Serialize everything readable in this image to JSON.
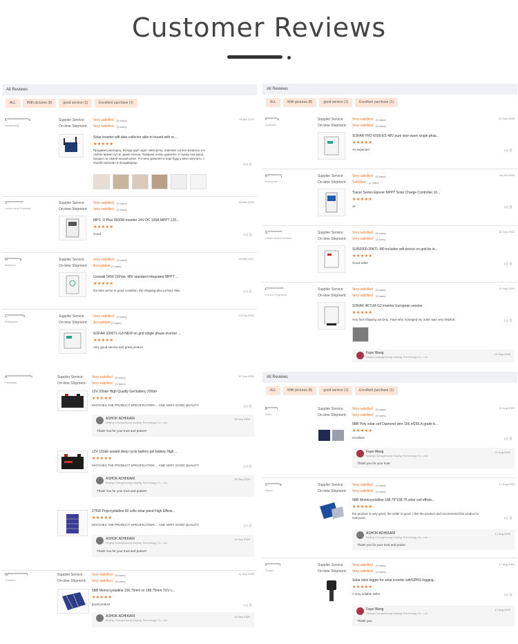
{
  "page_title": "Customer Reviews",
  "panel": {
    "header": "All Reviews",
    "chips": [
      "ALL",
      "With pictures (8)",
      "good service (1)",
      "Excellent purchase (1)"
    ]
  },
  "labels": {
    "supplier": "Supplier Service:",
    "shipment": "On-time Shipment:"
  },
  "left_top": [
    {
      "name": "K****************s",
      "country": "Kazakhstan",
      "date": "05 Apr 2021",
      "supplier": "Very satisfied",
      "supplier_sub": "(5 stars)",
      "shipment": "Very satisfied",
      "shipment_sub": "(5 stars)",
      "product": "Solar inverter wifi data collector able to bound with m...",
      "text": [
        "Продавец молодец, всегда идет идет навстречу, отвечает на все вопросы и в",
        "любое время суток, даже Ночью. Товаром очень доволен, и скажу она дала,",
        "продал по самой низкой цене. Я очень доволен и еще буду у мне покупать, с",
        "пасибо магазин и продавщице."
      ],
      "likes": "0"
    },
    {
      "name": "S************",
      "country": "United Arab Emirates",
      "date": "20 Mar 2021",
      "supplier": "Very satisfied",
      "supplier_sub": "(5 stars)",
      "shipment": "Very satisfied",
      "shipment_sub": "(5 stars)",
      "product": "MPS -V Plus 3500W inverter 24V DC 100A MPPT 120...",
      "text": [
        "Good"
      ],
      "likes": "0"
    },
    {
      "name": "M*********a",
      "country": "Malaysia",
      "date": "04 Mar 2021",
      "supplier": "Very satisfied",
      "supplier_sub": "(5 stars)",
      "shipment": "Acceptable",
      "shipment_sub": "(3 stars)",
      "product": "Growatt 5KW 230Vac 48V standard integrated MPPT ...",
      "text": [
        "the item arrive in good condition. the shipping also jut bad. thks"
      ],
      "likes": "0"
    },
    {
      "name": "C************s",
      "country": "Philippines",
      "date": "23 Feb 2021",
      "supplier": "Very satisfied",
      "supplier_sub": "(5 stars)",
      "shipment": "Acceptable",
      "shipment_sub": "(3 stars)",
      "product": "SOFAR 3300TL-G3-NEW on grid single phase inverter ...",
      "text": [
        "Very good service and great product"
      ],
      "likes": "0"
    }
  ],
  "left_bottom": {
    "name": "A******************r",
    "country": "Paraguay",
    "date": "12 Sep 2020",
    "supplier": "Very satisfied",
    "supplier_sub": "(5 stars)",
    "shipment": "Very satisfied",
    "shipment_sub": "(5 stars)",
    "items": [
      {
        "product": "12V 200ah High Quality Gel battery 200ah",
        "text": "MATCHES THE PRODUCT SPECIFICATION ... AND VERY GOOD QUALITY",
        "likes": "0",
        "reply_name": "ASHOK ADHIKARI",
        "reply_company": "Beijing Changchuang Kaiying Technology Co., Ltd.",
        "reply_date": "15 Sep 2020",
        "reply_text": "Thank You for your trust and praise!!"
      },
      {
        "product": "12V 150ah sealed deep cycle battery gel battery High ...",
        "text": "MATCHES THE PRODUCT SPECIFICATION ... AND VERY GOOD QUALITY",
        "likes": "0",
        "reply_name": "ASHOK ADHIKARI",
        "reply_company": "Beijing Changchuang Kaiying Technology Co., Ltd.",
        "reply_date": "15 Sep 2020",
        "reply_text": "Thank You for your trust and praise!!"
      },
      {
        "product": "275W Polycrystalline 60 cells solar panel high Efficie...",
        "text": "MATCHES THE PRODUCT SPECIFICATION ... AND VERY GOOD QUALITY",
        "likes": "0",
        "reply_name": "ASHOK ADHIKARI",
        "reply_company": "Beijing Changchuang Kaiying Technology Co., Ltd.",
        "reply_date": "15 Sep 2020",
        "reply_text": "Thank You for your trust and praise!!"
      }
    ],
    "next": {
      "name": "W**************r",
      "country": "Thailand",
      "date": "11 Sep 2020",
      "supplier": "Very satisfied",
      "supplier_sub": "(5 stars)",
      "shipment": "Very satisfied",
      "shipment_sub": "(5 stars)",
      "product": "5BB Monocrystalline 156.75mm or 158.75mm TUV c...",
      "text": "good product",
      "likes": "0",
      "reply_name": "ASHOK ADHIKARI",
      "reply_company": "Beijing Changchuang Kaiying Technology Co., Ltd.",
      "reply_date": "13 Sep 2020"
    }
  },
  "right_top": [
    {
      "name": "P*******a",
      "country": "Australia",
      "date": "01 Dec 2020",
      "supplier": "Very satisfied",
      "supplier_sub": "(5 stars)",
      "shipment": "Very satisfied",
      "shipment_sub": "(5 stars)",
      "product": "SOFAR HYD 6000-ES 48V pure sine wave single phas...",
      "text": "As expected",
      "likes": "0"
    },
    {
      "name": "R**********j",
      "country": "Indonesia",
      "date": "08 Oct 2020",
      "supplier": "Very satisfied",
      "supplier_sub": "(5 stars)",
      "shipment": "Satisfied",
      "shipment_sub": "(4 stars)",
      "product": "Tracer Series Epever MPPT Solar Charge Controller 10...",
      "text": "ok",
      "likes": "0"
    },
    {
      "name": "S***********",
      "country": "United Arab Emirates",
      "date": "30 Sep 2020",
      "supplier": "Very satisfied",
      "supplier_sub": "(5 stars)",
      "shipment": "Very satisfied",
      "shipment_sub": "(5 stars)",
      "product": "SUN2000-20KTL-M0 includes wifi device on grid tie in...",
      "text": "Good seller",
      "likes": "0"
    },
    {
      "name": "F************",
      "country": "French Polynesia",
      "date": "21 Sep 2020",
      "supplier": "Very satisfied",
      "supplier_sub": "(5 stars)",
      "shipment": "Very satisfied",
      "shipment_sub": "(5 stars)",
      "product": "SOFAR 4KTLM-G2 inverter European version",
      "text": "very fast shipping via DHL, Faye who managed my order was very helpfull.",
      "likes": "0",
      "reply_name": "Faye Wang",
      "reply_company": "Beijing Changchuang Kaiying Technology Co., Ltd.",
      "reply_date": "21 Sep 2020"
    }
  ],
  "right_bottom": [
    {
      "name": "B*******l",
      "country": "India",
      "date": "21 Aug 2020",
      "supplier": "Very satisfied",
      "supplier_sub": "(5 stars)",
      "shipment": "Very satisfied",
      "shipment_sub": "(5 stars)",
      "product": "5BB Poly solar cell Diamond wire 156 of156.A grade b...",
      "text": "excellent",
      "likes": "0",
      "reply_name": "Faye Wang",
      "reply_company": "Beijing Changchuang Kaiying Technology Co., Ltd.",
      "reply_date": "21 Aug 2020",
      "reply_text": "Thank you for your trust."
    },
    {
      "name": "S*********a",
      "country": "Nepal",
      "date": "17 Aug 2020",
      "supplier": "Very satisfied",
      "supplier_sub": "(5 stars)",
      "shipment": "Very satisfied",
      "shipment_sub": "(5 stars)",
      "product": "5BB Monocrystalline 158.75*158.75 solar cell efficie...",
      "text": "the product is very good. the seller is good. I like the product and recommend this product to everyone.",
      "likes": "0",
      "reply_name": "ASHOK ADHIKARI",
      "reply_company": "Beijing Changchuang Kaiying Technology Co., Ltd.",
      "reply_date": "17 Aug 2020",
      "reply_text": "Thank you for your trust and praise."
    },
    {
      "name": "P*********l",
      "country": "Poland",
      "date": "17 Aug 2020",
      "supplier": "Very satisfied",
      "supplier_sub": "(5 stars)",
      "shipment": "Very satisfied",
      "shipment_sub": "(5 stars)",
      "product": "Solar stick logger for solar inverter wifi/GPRS logging...",
      "text": "A very reliable seller",
      "likes": "0",
      "reply_name": "Faye Wang",
      "reply_company": "Beijing Changchuang Kaiying Technology Co., Ltd.",
      "reply_date": "17 Aug 2020",
      "reply_text": "Thank you."
    }
  ],
  "stars": "★★★★★",
  "like_icon": "thumbs-up-icon",
  "colors": {
    "accent": "#f56f1e",
    "chip_bg": "#fde6d8",
    "header_bg": "#f0f1f4"
  }
}
